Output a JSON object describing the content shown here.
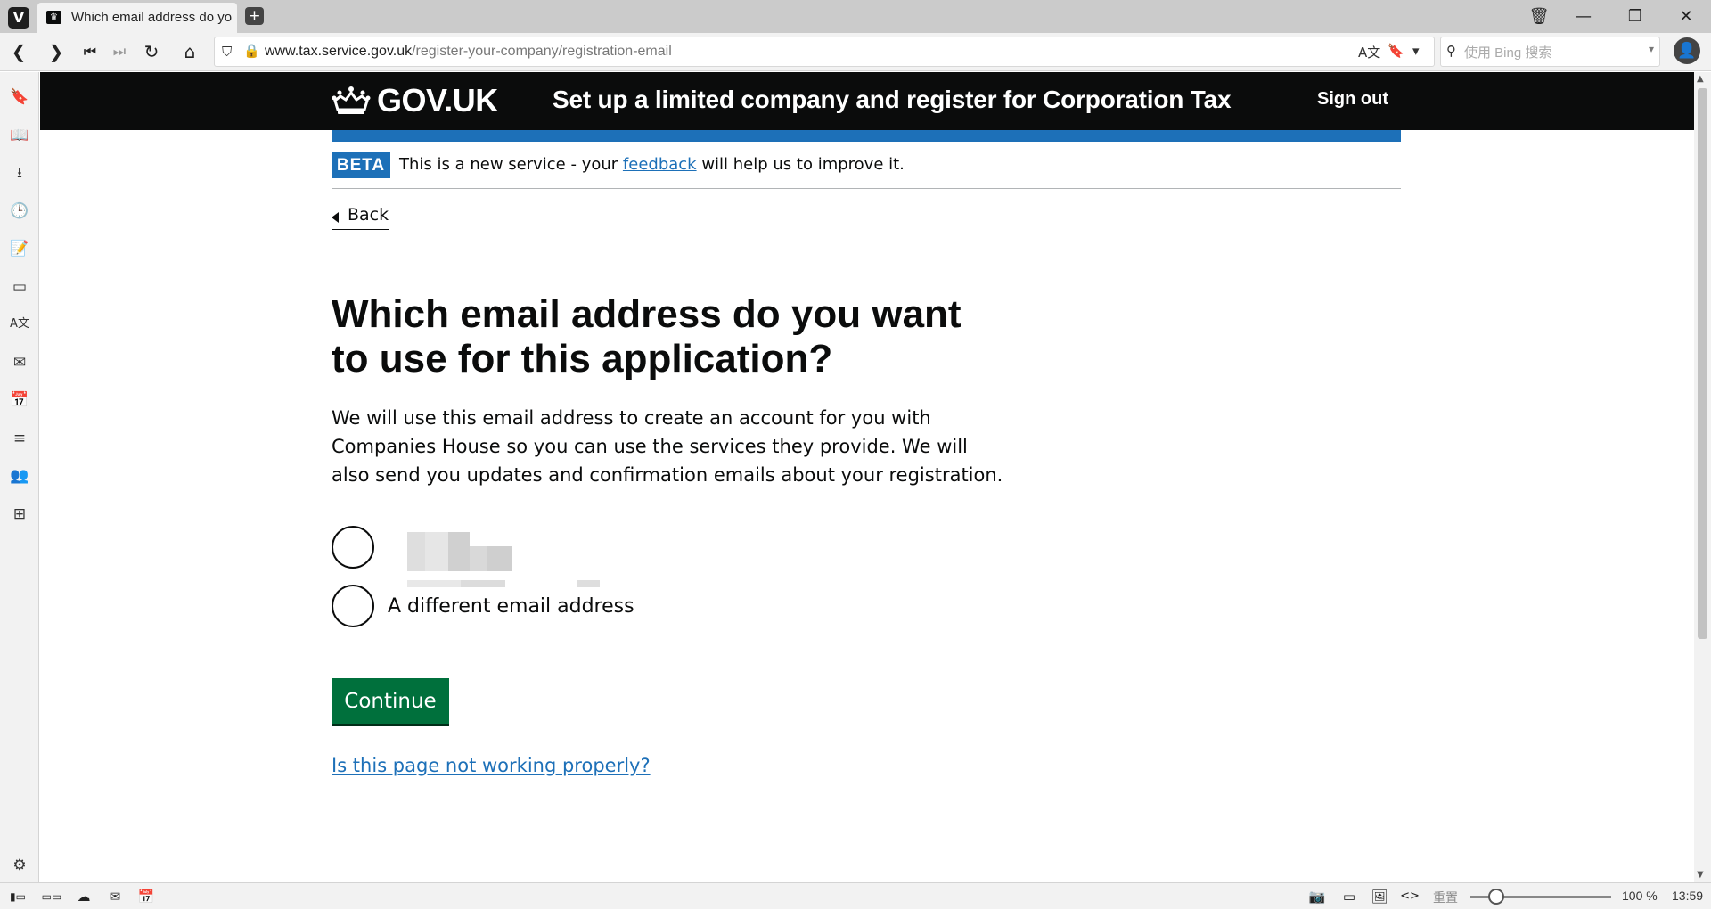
{
  "browser": {
    "tab_title": "Which email address do yo",
    "new_tab_icon": "+",
    "url_domain": "www.tax.service.gov.uk",
    "url_path": "/register-your-company/registration-email",
    "search_placeholder": "使用 Bing 搜索",
    "icons": {
      "back": "❮",
      "forward": "❯",
      "rewind": "⏮",
      "fastforward": "⏭",
      "reload": "↻",
      "home": "⌂",
      "shield": "⛉",
      "lock": "🔒",
      "translate": "A文",
      "bookmark": "🔖",
      "dropdown": "▾",
      "search": "⚲",
      "profile": "👤",
      "trash": "🗑",
      "minimize": "—",
      "restore": "❐",
      "close": "✕"
    },
    "sidebar_icons": [
      "🔖",
      "📖",
      "⭳",
      "🕒",
      "📝",
      "▭",
      "A文",
      "✉",
      "📅",
      "≡",
      "👥",
      "⊞",
      "⚙"
    ],
    "status": {
      "zoom_label": "重置",
      "zoom_level": "100 %",
      "clock": "13:59",
      "left_icons": [
        "▮▭",
        "▭▭",
        "☁",
        "✉",
        "📅"
      ],
      "right_icons": [
        "📷",
        "▭",
        "🖼",
        "<>"
      ]
    }
  },
  "header": {
    "logotype": "GOV.UK",
    "service_name": "Set up a limited company and register for Corporation Tax",
    "sign_out": "Sign out"
  },
  "phase_banner": {
    "tag": "BETA",
    "text_before": "This is a new service - your ",
    "link": "feedback",
    "text_after": " will help us to improve it."
  },
  "back_link": "Back",
  "main": {
    "heading": "Which email address do you want to use for this application?",
    "lede": "We will use this email address to create an account for you with Companies House so you can use the services they provide. We will also send you updates and confirmation emails about your registration.",
    "options": [
      {
        "label": "",
        "redacted": true
      },
      {
        "label": "A different email address"
      }
    ],
    "continue_button": "Continue",
    "help_link": "Is this page not working properly?"
  },
  "colors": {
    "header_bg": "#0b0c0c",
    "brand_blue": "#1d70b8",
    "button_green": "#00703c"
  }
}
